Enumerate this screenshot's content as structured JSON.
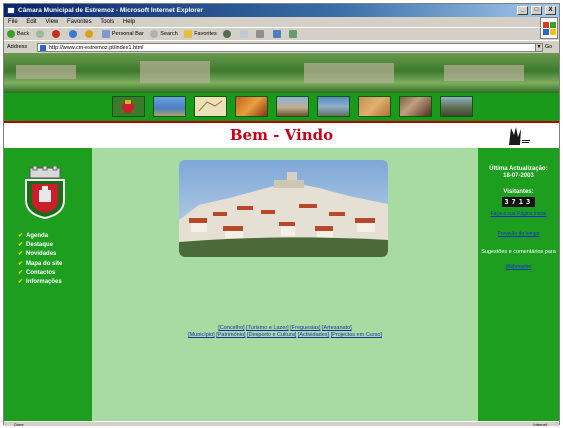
{
  "window": {
    "title": "Câmara Municipal de Estremoz - Microsoft Internet Explorer",
    "controls": [
      "_",
      "□",
      "X"
    ]
  },
  "menubar": [
    "File",
    "Edit",
    "View",
    "Favorites",
    "Tools",
    "Help"
  ],
  "toolbar": {
    "back_label": "Back",
    "personalbar_label": "Personal Bar",
    "search_label": "Search",
    "favorites_label": "Favorites"
  },
  "addressbar": {
    "label": "Address",
    "url": "http://www.cm-estremoz.pt/index1.html",
    "go_label": "Go"
  },
  "page": {
    "welcome": "Bem - Vindo",
    "left_menu": [
      "Agenda",
      "Destaque",
      "Novidades",
      "Mapa do site",
      "Contactos",
      "Informações"
    ],
    "links_row1": [
      "[Concelho]",
      "[Turismo e Lazer]",
      "[Freguesias]",
      "[Artesanato]"
    ],
    "links_row2": [
      "[Município]",
      "[Património]",
      "[Desporto e Cultura]",
      "[Actividades]",
      "[Projectos em Curso]"
    ],
    "last_update_label": "Última Actualização:",
    "last_update_date": "18-07-2003",
    "visitors_label": "Visitantes:",
    "visitor_count": "3713",
    "homepage_link": "Faça-a sua Página inicial",
    "weather_link": "Previsão do tempo",
    "suggestions_text": "Sugestões e comentários para",
    "webmaster_link": "Webmaster"
  },
  "statusbar": {
    "left": "Done",
    "right": "Internet"
  },
  "colors": {
    "titlebar": "#0a246a",
    "page_green": "#1e9e1e",
    "center_green": "#a7dba2",
    "welcome_red": "#c8001a",
    "link_blue": "#1a2fb0"
  }
}
